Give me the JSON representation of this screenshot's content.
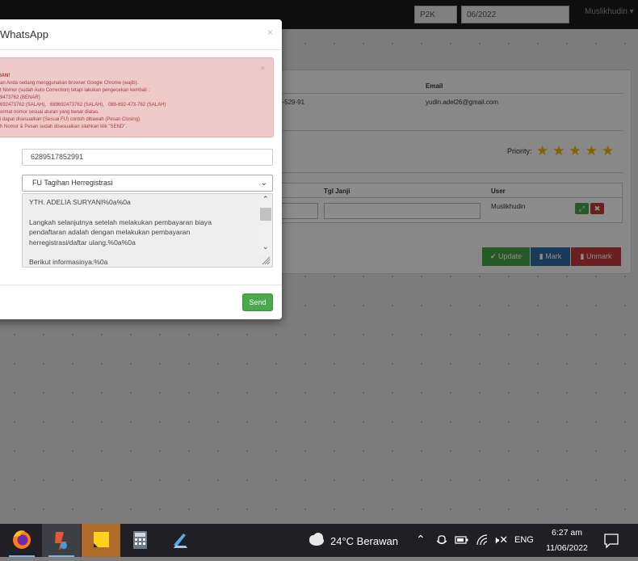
{
  "topbar": {
    "program_select": "P2K",
    "period_input": "06/2022",
    "user_menu": "Muslikhudin ▾"
  },
  "background": {
    "email_header": "Email",
    "phone_value": "3-529-91",
    "email_value": "yudin.adel26@gmail.com",
    "priority_label": "Priority:",
    "priority_stars": 5,
    "table_headers": {
      "tgl_janji": "Tgl Janji",
      "user": "User"
    },
    "table_user_value": "Muslikhudin",
    "buttons": {
      "update": "Update",
      "mark": "Mark",
      "unmark": "Unmark"
    }
  },
  "modal": {
    "title": "WhatsApp",
    "close": "×",
    "alert": {
      "close": "×",
      "lines": [
        "IAN!",
        "an Anda sedang menggunakan browser Google Chrome (wajib).",
        "t Nomor (sudah Auto Correction) tetapi lakukan pengecekan kembali :",
        "9473762 (BENAR)",
        "692473762 (SALAH),   689692473762 (SALAH),   089-692-473-762 (SALAH)",
        "ormat nomor sesuai aturan yang benar diatas.",
        "i dapat disesuaikan (Sesuai FU) contoh dibawah (Pesan Closing).",
        "h Nomor & Pesan sudah disesuaikan silahkan klik \"SEND\"."
      ]
    },
    "phone_label": "ne",
    "phone_value": "6289517852991",
    "message_label": "ge",
    "message_type_selected": "FU Tagihan Herregistrasi",
    "message_text": "YTH. ADELIA SURYANI%0a%0a\n\nLangkah selanjutnya setelah melakukan pembayaran biaya pendaftaran adalah dengan melakukan pembayaran herregistrasi/daftar ulang.%0a%0a\n\nBerikut informasinya:%0a",
    "send_label": "Send"
  },
  "taskbar": {
    "weather": "24°C  Berawan",
    "language": "ENG",
    "time": "6:27 am",
    "date": "11/06/2022"
  },
  "colors": {
    "send_green": "#4aa94a",
    "alert_bg": "#efcaca",
    "update_green": "#44a244",
    "mark_blue": "#2f6aa7",
    "unmark_red": "#c43a3a",
    "star": "#f0b400"
  }
}
